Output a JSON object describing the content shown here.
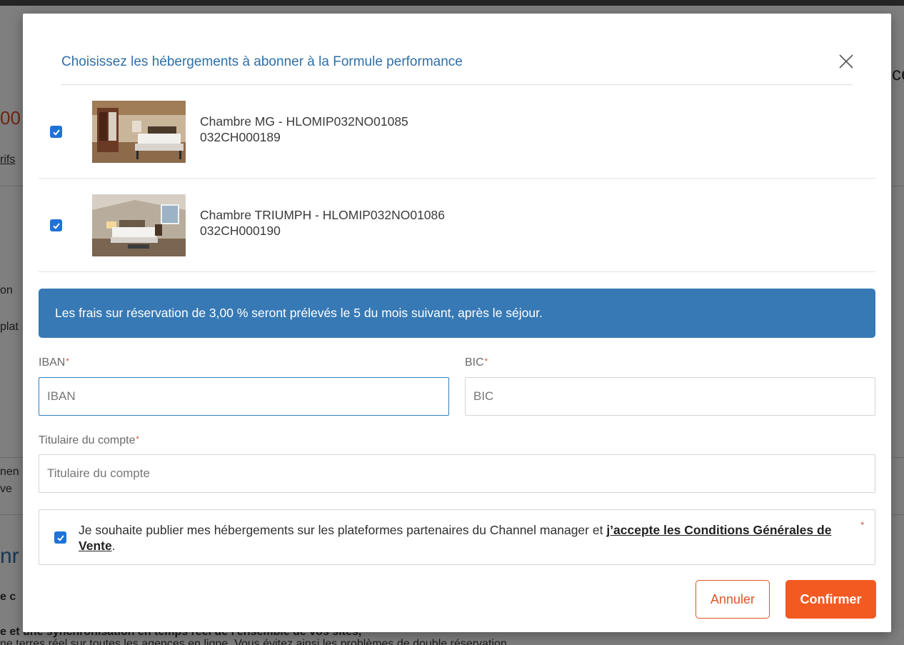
{
  "background_page": {
    "fragments": [
      "00",
      "rifs",
      "on",
      "plat",
      "nen",
      "ve",
      "nr",
      "e c",
      "e et une synchronisation en temps réel de l'ensemble de vos sites,",
      "ne terres réel sur toutes les agences en ligne. Vous évitez ainsi les problèmes de double réservation",
      "ce"
    ]
  },
  "modal": {
    "title": "Choisissez les hébergements à abonner à la Formule performance",
    "close_icon": "close-icon",
    "rooms": [
      {
        "checked": true,
        "name": "Chambre MG - HLOMIP032NO01085",
        "code": "032CH000189",
        "thumb": "bedroom-photo"
      },
      {
        "checked": true,
        "name": "Chambre TRIUMPH - HLOMIP032NO01086",
        "code": "032CH000190",
        "thumb": "bedroom-photo"
      }
    ],
    "info_banner": "Les frais sur réservation de 3,00 % seront prélevés le 5 du mois suivant, après le séjour.",
    "fields": {
      "iban": {
        "label": "IBAN",
        "required_mark": "*",
        "placeholder": "IBAN",
        "value": ""
      },
      "bic": {
        "label": "BIC",
        "required_mark": "*",
        "placeholder": "BIC",
        "value": ""
      },
      "holder": {
        "label": "Titulaire du compte",
        "required_mark": "*",
        "placeholder": "Titulaire du compte",
        "value": ""
      }
    },
    "consent": {
      "checked": true,
      "text_before": "Je souhaite publier mes hébergements sur les plateformes partenaires du Channel manager et ",
      "link_text": "j’accepte les Conditions Générales de Vente",
      "text_after": ".",
      "required_mark": "*"
    },
    "buttons": {
      "cancel_label": "Annuler",
      "confirm_label": "Confirmer"
    },
    "colors": {
      "accent_orange": "#f25a22",
      "title_blue": "#2f6fa7",
      "banner_blue": "#3779b4",
      "checkbox_blue": "#1f73d6"
    }
  }
}
